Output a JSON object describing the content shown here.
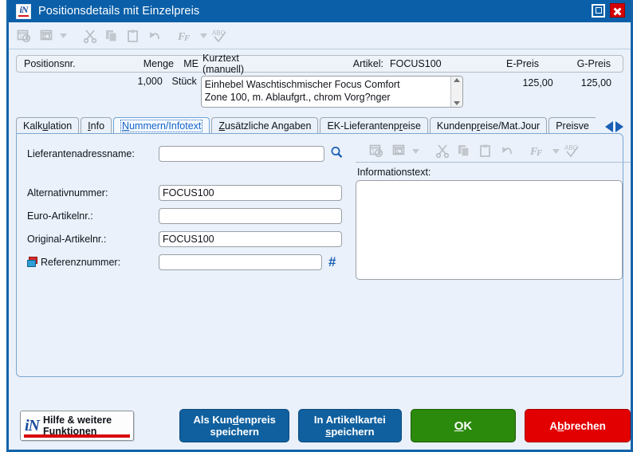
{
  "window": {
    "title": "Positionsdetails mit Einzelpreis",
    "logo_text": "iN",
    "maximize_label": "Maximieren",
    "close_label": "Schließen"
  },
  "toolbar": {
    "items": [
      {
        "name": "date-time-icon",
        "label": "Datum/Uhrzeit einfügen"
      },
      {
        "name": "image-icon",
        "label": "Bild einfügen"
      },
      {
        "name": "cut-icon",
        "label": "Ausschneiden"
      },
      {
        "name": "copy-icon",
        "label": "Kopieren"
      },
      {
        "name": "paste-icon",
        "label": "Einfügen"
      },
      {
        "name": "undo-icon",
        "label": "Rückgängig"
      },
      {
        "name": "font-icon",
        "label": "Schriftart"
      },
      {
        "name": "spellcheck-icon",
        "label": "Rechtschreibprüfung"
      }
    ]
  },
  "position_header": {
    "columns": {
      "positionsnr": "Positionsnr.",
      "menge": "Menge",
      "me": "ME",
      "kurztext": "Kurztext (manuell)",
      "artikel_label": "Artikel:",
      "artikel_value": "FOCUS100",
      "e_preis": "E-Preis",
      "g_preis": "G-Preis"
    },
    "values": {
      "positionsnr": "",
      "menge": "1,000",
      "me": "Stück",
      "kurztext_line1": "Einhebel Waschtischmischer Focus Comfort",
      "kurztext_line2": "Zone 100, m. Ablaufgrt., chrom Vorg?nger",
      "e_preis": "125,00",
      "g_preis": "125,00"
    }
  },
  "tabs": {
    "items": [
      {
        "label": "Kalkulation",
        "pre": "Kalk",
        "accel": "u",
        "post": "lation",
        "active": false
      },
      {
        "label": "Info",
        "pre": "",
        "accel": "I",
        "post": "nfo",
        "active": false
      },
      {
        "label": "Nummern/Infotext",
        "pre": "",
        "accel": "N",
        "post": "ummern/Infotext",
        "active": true
      },
      {
        "label": "Zusätzliche Angaben",
        "pre": "",
        "accel": "Z",
        "post": "usätzliche Angaben",
        "active": false
      },
      {
        "label": "EK-Lieferantenpreise",
        "pre": "EK-Lieferantenp",
        "accel": "r",
        "post": "eise",
        "active": false
      },
      {
        "label": "Kundenpreise/Mat.Jour",
        "pre": "Kundenp",
        "accel": "r",
        "post": "eise/Mat.Jour",
        "active": false
      },
      {
        "label": "Preisve",
        "pre": "Preisve",
        "accel": "",
        "post": "",
        "active": false
      }
    ],
    "nav_prev": "Vorherige Registerkarten",
    "nav_next": "Nächste Registerkarten"
  },
  "form": {
    "lieferantenadressname": {
      "label": "Lieferantenadressname:",
      "value": "",
      "placeholder": ""
    },
    "alternativnummer": {
      "label": "Alternativnummer:",
      "value": "FOCUS100",
      "placeholder": ""
    },
    "euro_artikelnr": {
      "label": "Euro-Artikelnr.:",
      "value": "",
      "placeholder": ""
    },
    "original_artikelnr": {
      "label": "Original-Artikelnr.:",
      "value": "FOCUS100",
      "placeholder": ""
    },
    "referenznummer": {
      "label": "Referenznummer:",
      "value": "",
      "placeholder": ""
    },
    "search_icon_label": "Suchen",
    "hash_icon_label": "#"
  },
  "infotext": {
    "label": "Informationstext:",
    "value": "",
    "placeholder": ""
  },
  "footer": {
    "help": {
      "line1": "Hilfe & weitere",
      "line2": "Funktionen",
      "logo": "iN"
    },
    "save_customer_price": {
      "pre": "Als Kun",
      "accel": "d",
      "post": "enpreis",
      "line2_pre": "",
      "line2_accel": "",
      "line2_post": "speichern"
    },
    "save_article": {
      "line1": "In Artikelkartei",
      "line2_pre": "",
      "line2_accel": "s",
      "line2_post": "peichern"
    },
    "ok": {
      "pre": "",
      "accel": "O",
      "post": "K"
    },
    "cancel": {
      "pre": "A",
      "accel": "b",
      "post": "brechen"
    }
  },
  "colors": {
    "titlebar": "#0a5fa8",
    "window_bg": "#eaf1fa",
    "accent_blue": "#10609f",
    "ok_green": "#2b8a0b",
    "cancel_red": "#e20000",
    "active_tab_text": "#1464c8"
  }
}
